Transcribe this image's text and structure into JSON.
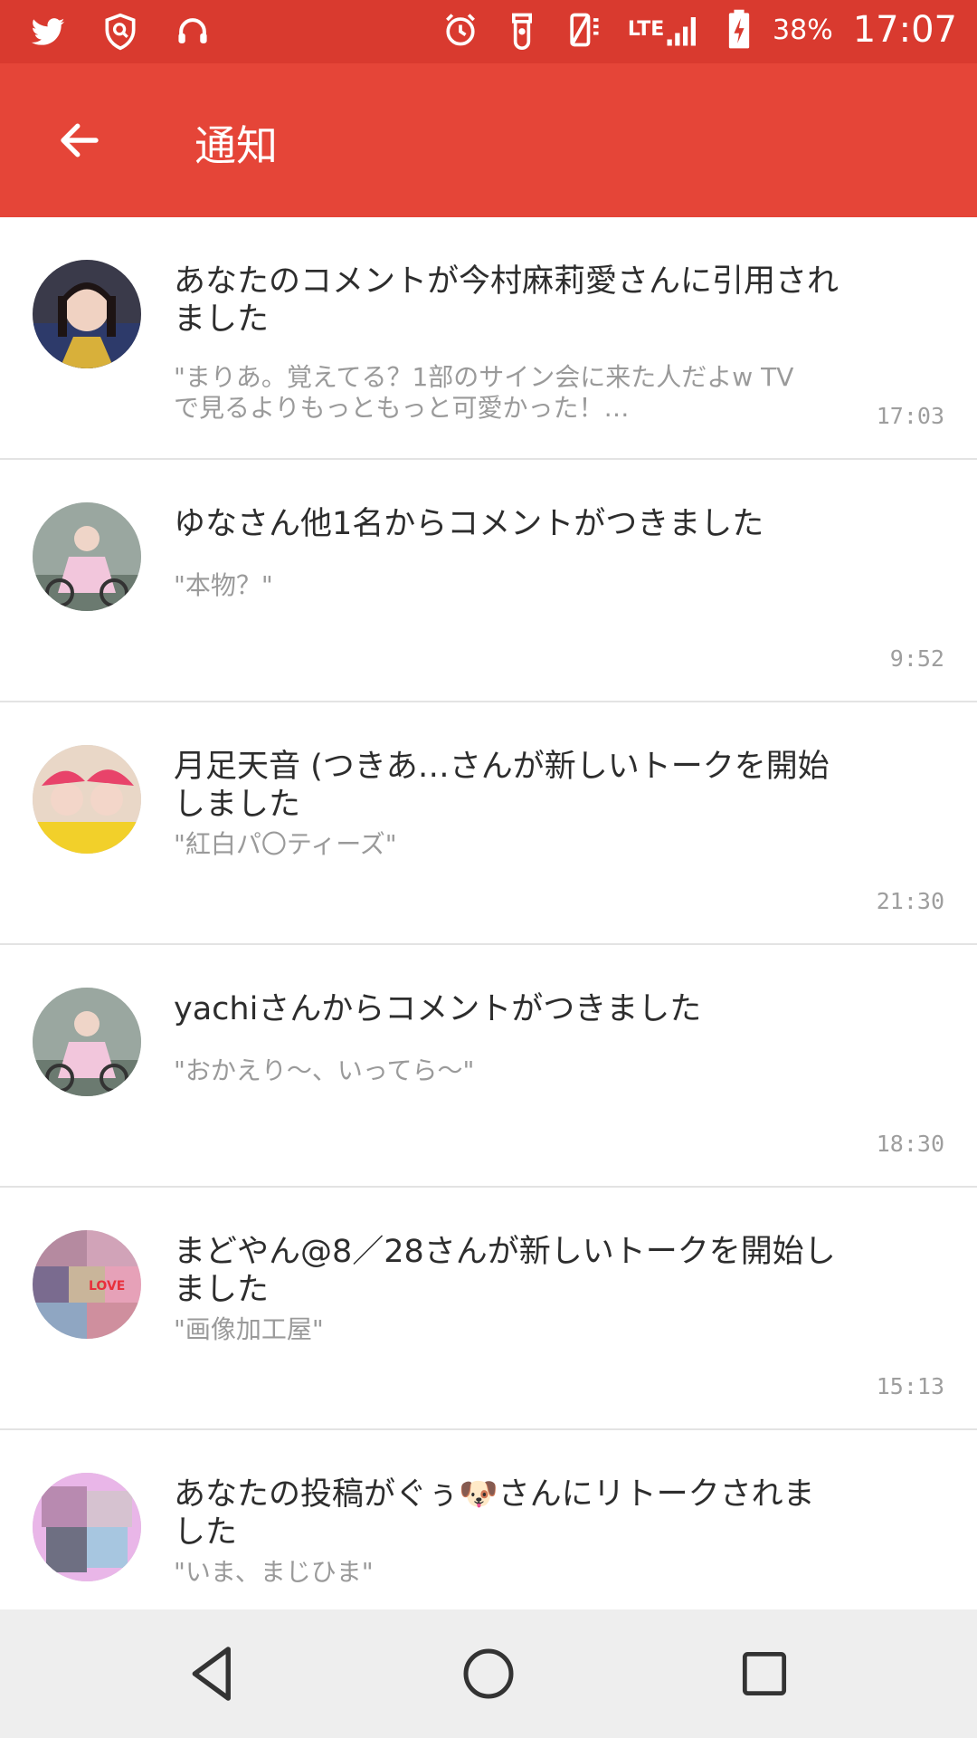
{
  "status_bar": {
    "left_icons": [
      "twitter-icon",
      "shield-search-icon",
      "headset-icon"
    ],
    "right_icons": [
      "alarm-icon",
      "keyguard-icon",
      "battery-saver-icon"
    ],
    "network": "LTE",
    "battery": "38%",
    "time": "17:07",
    "colors": {
      "bar": "#d93a2f"
    }
  },
  "app_bar": {
    "title": "通知",
    "back_icon": "arrow-left-icon",
    "colors": {
      "bar": "#e54538"
    }
  },
  "notifications": [
    {
      "title": "あなたのコメントが今村麻莉愛さんに引用されました",
      "quote": "\"まりあ。覚えてる？1部のサイン会に来た人だよw TVで見るよりもっともっと可愛かった！…",
      "time": "17:03"
    },
    {
      "title": "ゆなさん他1名からコメントがつきました",
      "quote": "\"本物？\"",
      "time": "9:52"
    },
    {
      "title": "月足天音 (つきあ…さんが新しいトークを開始しました",
      "quote": "\"紅白パ〇ティーズ\"",
      "time": "21:30"
    },
    {
      "title": "yachiさんからコメントがつきました",
      "quote": "\"おかえり〜、いってら〜\"",
      "time": "18:30"
    },
    {
      "title": "まどやん@8／28さんが新しいトークを開始しました",
      "quote": "\"画像加工屋\"",
      "time": "15:13"
    },
    {
      "title": "あなたの投稿がぐぅ🐶さんにリトークされました",
      "quote": "\"いま、まじひま\"",
      "time": ""
    }
  ],
  "nav_bar": {
    "icons": [
      "back-triangle-icon",
      "home-circle-icon",
      "recents-square-icon"
    ]
  }
}
